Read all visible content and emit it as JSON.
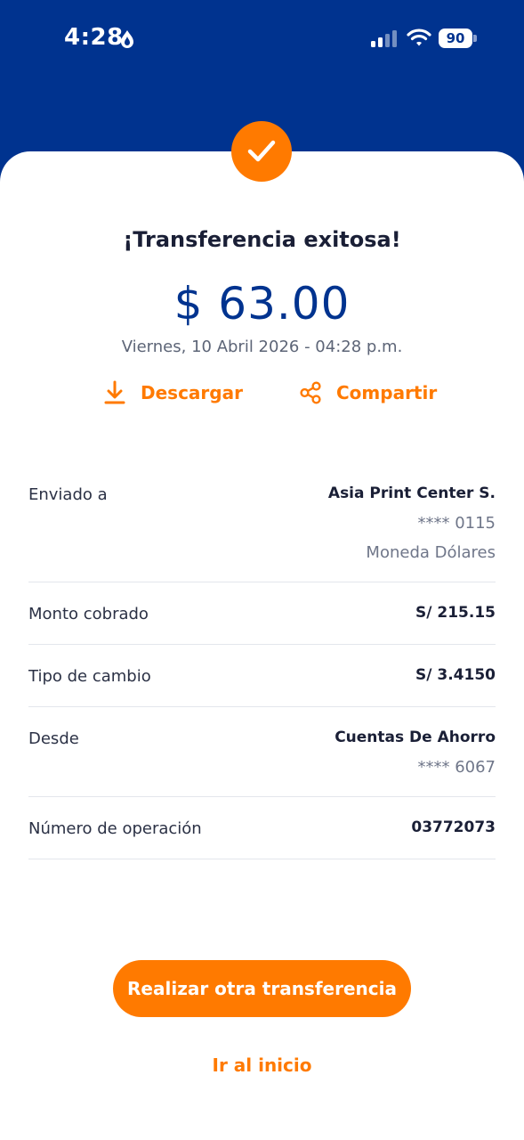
{
  "status_bar": {
    "time": "4:28",
    "battery": "90",
    "icons": [
      "drop-icon",
      "signal-icon",
      "wifi-icon",
      "battery-icon"
    ]
  },
  "receipt": {
    "title": "¡Transferencia exitosa!",
    "amount": "$ 63.00",
    "datetime": "Viernes, 10 Abril 2026 - 04:28 p.m.",
    "download_label": "Descargar",
    "share_label": "Compartir"
  },
  "details": {
    "sent_to": {
      "label": "Enviado a",
      "name": "Asia Print Center S.",
      "account": "**** 0115",
      "currency": "Moneda Dólares"
    },
    "charged": {
      "label": "Monto cobrado",
      "value": "S/ 215.15"
    },
    "exchange": {
      "label": "Tipo de cambio",
      "value": "S/ 3.4150"
    },
    "from": {
      "label": "Desde",
      "value": "Cuentas De Ahorro",
      "account": "**** 6067"
    },
    "operation": {
      "label": "Número de operación",
      "value": "03772073"
    }
  },
  "actions": {
    "new_transfer": "Realizar otra transferencia",
    "home": "Ir al inicio"
  },
  "colors": {
    "brand_blue": "#00338f",
    "accent_orange": "#ff7a00",
    "text_dark": "#1a1f36",
    "text_muted": "#6f7689",
    "divider": "#e3e6ec"
  }
}
